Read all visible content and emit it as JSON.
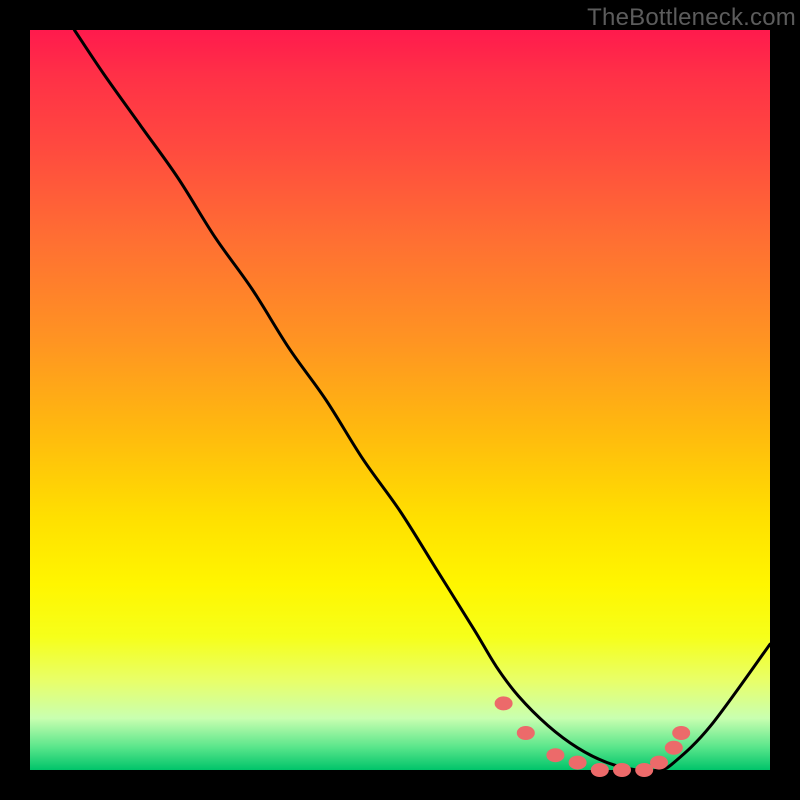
{
  "watermark": "TheBottleneck.com",
  "chart_data": {
    "type": "line",
    "title": "",
    "xlabel": "",
    "ylabel": "",
    "xlim": [
      0,
      100
    ],
    "ylim": [
      0,
      100
    ],
    "grid": false,
    "legend": false,
    "series": [
      {
        "name": "curve",
        "x": [
          6,
          10,
          15,
          20,
          25,
          30,
          35,
          40,
          45,
          50,
          55,
          60,
          63,
          66,
          70,
          74,
          78,
          82,
          85,
          87,
          92,
          100
        ],
        "y": [
          100,
          94,
          87,
          80,
          72,
          65,
          57,
          50,
          42,
          35,
          27,
          19,
          14,
          10,
          6,
          3,
          1,
          0,
          0,
          1,
          6,
          17
        ]
      }
    ],
    "markers": [
      {
        "x": 64,
        "y": 9
      },
      {
        "x": 67,
        "y": 5
      },
      {
        "x": 71,
        "y": 2
      },
      {
        "x": 74,
        "y": 1
      },
      {
        "x": 77,
        "y": 0
      },
      {
        "x": 80,
        "y": 0
      },
      {
        "x": 83,
        "y": 0
      },
      {
        "x": 85,
        "y": 1
      },
      {
        "x": 87,
        "y": 3
      },
      {
        "x": 88,
        "y": 5
      }
    ],
    "marker_color": "#ec6a6a",
    "curve_color": "#000000",
    "background_gradient": [
      {
        "stop": 0,
        "color": "#ff1a4d"
      },
      {
        "stop": 50,
        "color": "#ffcc00"
      },
      {
        "stop": 90,
        "color": "#f0ff7a"
      },
      {
        "stop": 100,
        "color": "#00c46a"
      }
    ]
  }
}
